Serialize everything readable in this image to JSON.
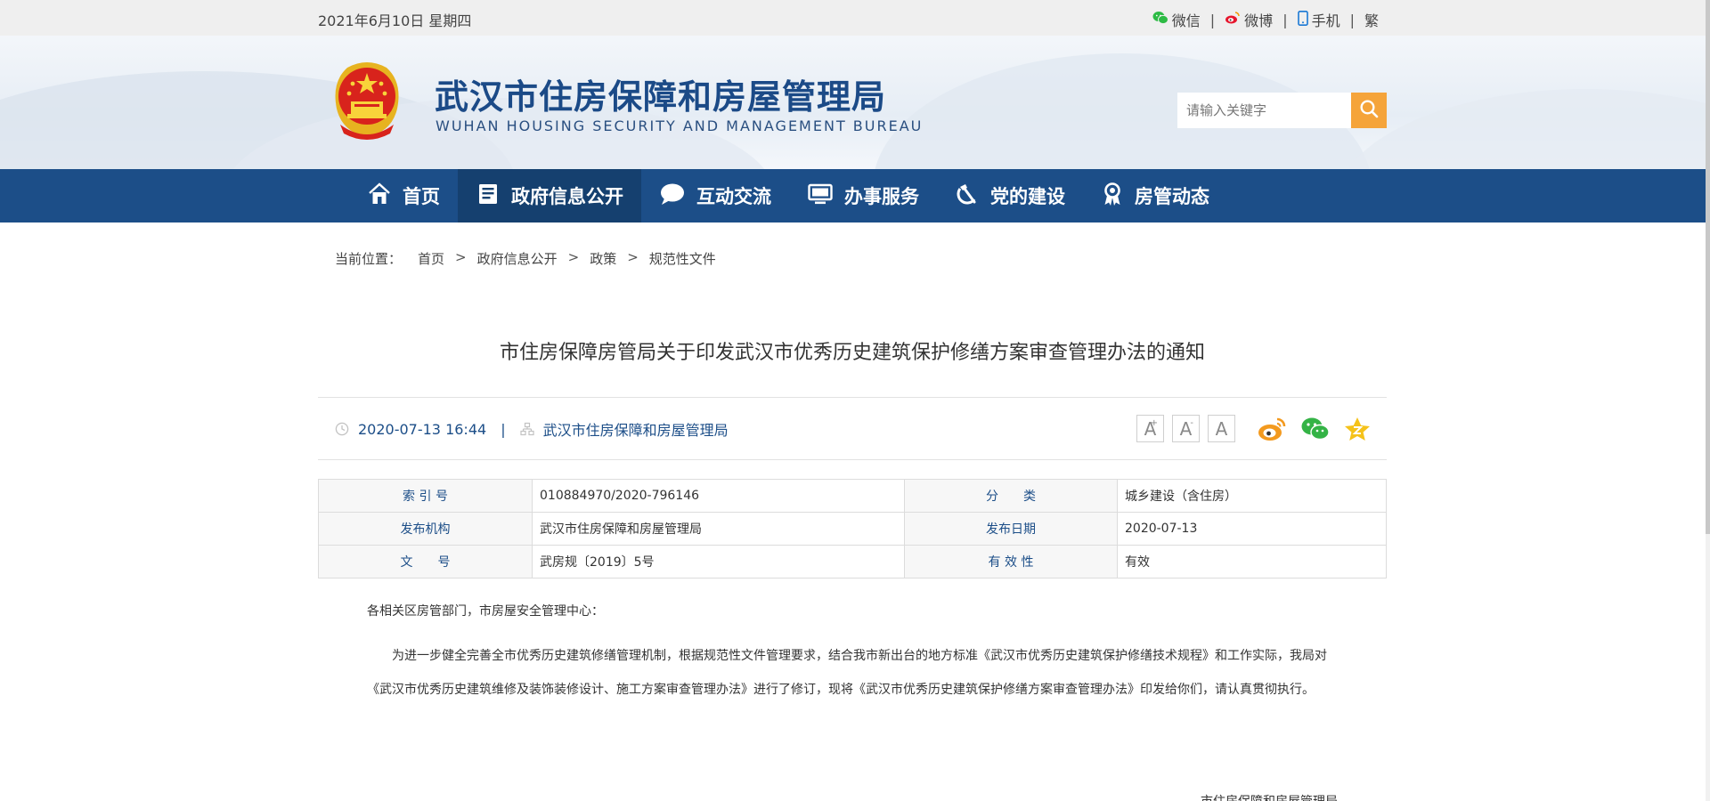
{
  "topbar": {
    "date": "2021年6月10日 星期四",
    "links": [
      {
        "label": "微信",
        "icon": "wechat-icon"
      },
      {
        "label": "微博",
        "icon": "weibo-icon"
      },
      {
        "label": "手机",
        "icon": "mobile-icon"
      },
      {
        "label": "繁"
      }
    ],
    "separator": "|"
  },
  "header": {
    "site_name": "武汉市住房保障和房屋管理局",
    "site_name_en": "WUHAN HOUSING SECURITY AND MANAGEMENT BUREAU",
    "search_placeholder": "请输入关键字",
    "emblem_icon": "national-emblem-icon"
  },
  "nav": {
    "items": [
      {
        "label": "首页",
        "icon": "home-icon"
      },
      {
        "label": "政府信息公开",
        "icon": "document-icon"
      },
      {
        "label": "互动交流",
        "icon": "chat-icon"
      },
      {
        "label": "办事服务",
        "icon": "monitor-icon"
      },
      {
        "label": "党的建设",
        "icon": "hammer-sickle-icon"
      },
      {
        "label": "房管动态",
        "icon": "badge-icon"
      }
    ],
    "active_index": 1
  },
  "breadcrumb": {
    "label": "当前位置：",
    "items": [
      "首页",
      "政府信息公开",
      "政策",
      "规范性文件"
    ],
    "separator": ">"
  },
  "article": {
    "title": "市住房保障房管局关于印发武汉市优秀历史建筑保护修缮方案审查管理办法的通知",
    "datetime": "2020-07-13 16:44",
    "meta_sep": "|",
    "source": "武汉市住房保障和房屋管理局",
    "font_buttons": [
      {
        "label": "A",
        "mark": "+"
      },
      {
        "label": "A",
        "mark": "-"
      },
      {
        "label": "A",
        "mark": ""
      }
    ],
    "share_icons": [
      "weibo-share-icon",
      "wechat-share-icon",
      "favorite-star-icon"
    ]
  },
  "info_table": {
    "rows": [
      [
        {
          "k": "索 引 号",
          "v": "010884970/2020-796146"
        },
        {
          "k": "分　　类",
          "v": "城乡建设（含住房）"
        }
      ],
      [
        {
          "k": "发布机构",
          "v": "武汉市住房保障和房屋管理局"
        },
        {
          "k": "发布日期",
          "v": "2020-07-13"
        }
      ],
      [
        {
          "k": "文　　号",
          "v": "武房规〔2019〕5号"
        },
        {
          "k": "有 效 性",
          "v": "有效"
        }
      ]
    ]
  },
  "body": {
    "greeting": "各相关区房管部门，市房屋安全管理中心：",
    "paragraph": "为进一步健全完善全市优秀历史建筑修缮管理机制，根据规范性文件管理要求，结合我市新出台的地方标准《武汉市优秀历史建筑保护修缮技术规程》和工作实际，我局对《武汉市优秀历史建筑维修及装饰装修设计、施工方案审查管理办法》进行了修订，现将《武汉市优秀历史建筑保护修缮方案审查管理办法》印发给你们，请认真贯彻执行。",
    "signature": "市住房保障和房屋管理局"
  },
  "colors": {
    "nav_bg": "#1c4e88",
    "nav_active": "#15406f",
    "search_button": "#f5a43a",
    "brand_text": "#1b4a87"
  }
}
